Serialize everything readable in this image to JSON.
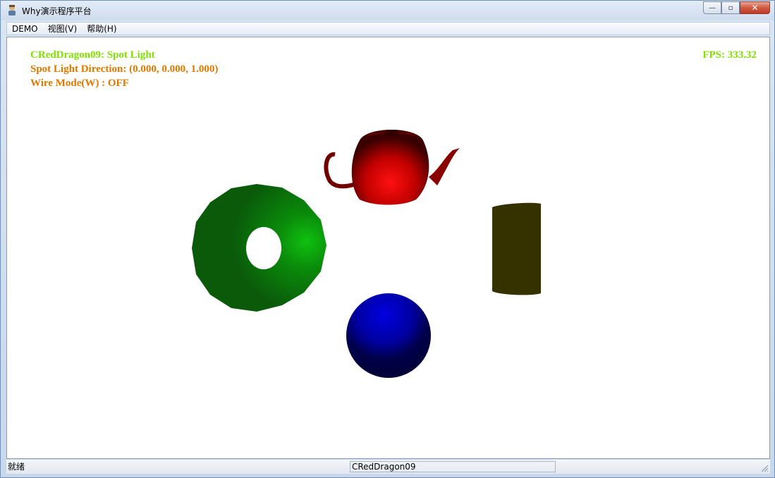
{
  "window": {
    "title": "Why演示程序平台",
    "controls": {
      "minimize": "—",
      "maximize": "▫",
      "close": "✕"
    }
  },
  "menu": [
    {
      "label": "DEMO"
    },
    {
      "label": "视图(V)"
    },
    {
      "label": "帮助(H)"
    }
  ],
  "overlay": {
    "demo_name": "CRedDragon09: Spot Light",
    "spot_direction": "Spot Light Direction: (0.000, 0.000, 1.000)",
    "wire_mode": "Wire Mode(W) : OFF",
    "fps": "FPS: 333.32",
    "colors": {
      "green": "#80e000",
      "orange": "#e07800"
    }
  },
  "scene": {
    "objects": [
      {
        "name": "teapot",
        "color": "#d40000"
      },
      {
        "name": "torus",
        "color": "#0a6a0a"
      },
      {
        "name": "cylinder",
        "color": "#3a3600"
      },
      {
        "name": "sphere",
        "color": "#0000b0"
      }
    ]
  },
  "status": {
    "ready": "就绪",
    "pane2": "CRedDragon09"
  }
}
